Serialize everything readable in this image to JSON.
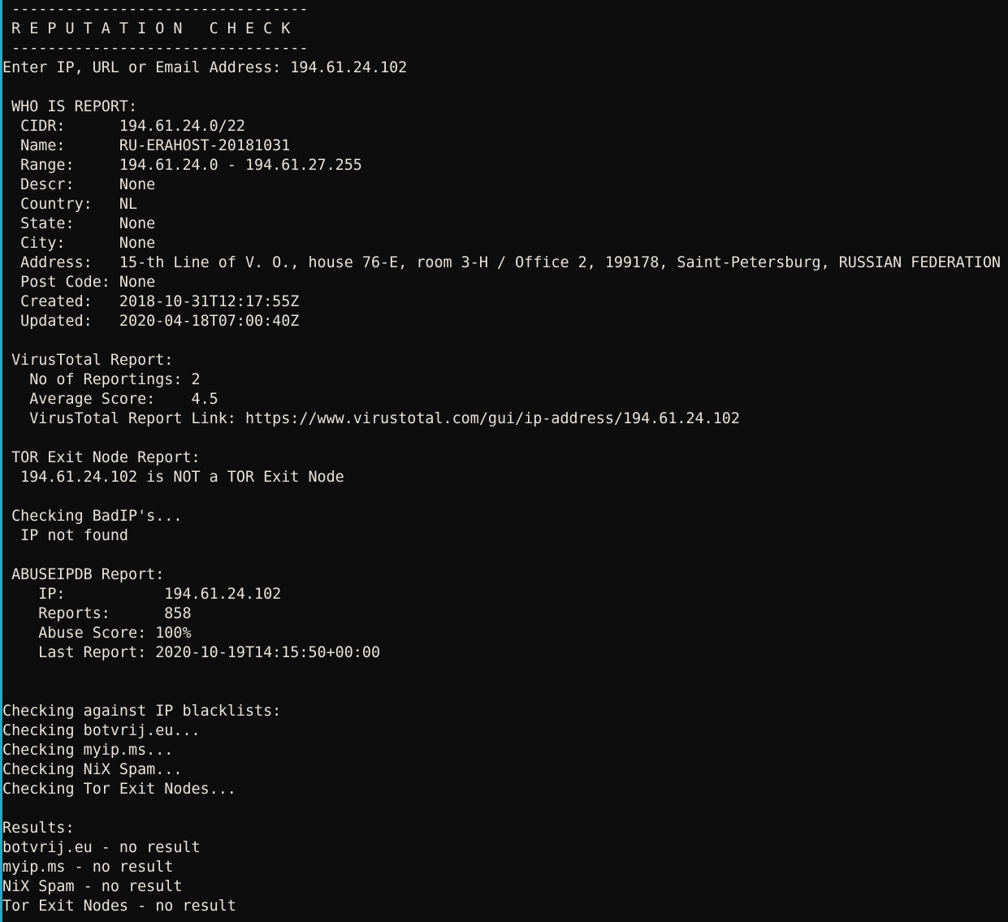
{
  "terminal": {
    "app_title": "Reputation Check",
    "background_color": "#0d0d0d",
    "text_color": "#e9e2da",
    "edge_accent_color": "#2aa8c4",
    "font_size_px": 18,
    "line_height_px": 24,
    "columns": 113,
    "rows": 47
  },
  "banner": {
    "rule_top": "---------------------------------",
    "title": "R E P U T A T I O N   C H E C K",
    "rule_bottom": "---------------------------------"
  },
  "prompt": {
    "label": "Enter IP, URL or Email Address:",
    "value": "194.61.24.102",
    "full_line": "Enter IP, URL or Email Address: 194.61.24.102"
  },
  "whois": {
    "heading": "WHO IS REPORT:",
    "fields": [
      {
        "label": "CIDR:",
        "value": "194.61.24.0/22"
      },
      {
        "label": "Name:",
        "value": "RU-ERAHOST-20181031"
      },
      {
        "label": "Range:",
        "value": "194.61.24.0 - 194.61.27.255"
      },
      {
        "label": "Descr:",
        "value": "None"
      },
      {
        "label": "Country:",
        "value": "NL"
      },
      {
        "label": "State:",
        "value": "None"
      },
      {
        "label": "City:",
        "value": "None"
      },
      {
        "label": "Address:",
        "value": "15-th Line of V. O., house 76-E, room 3-H / Office 2, 199178, Saint-Petersburg, RUSSIAN FEDERATION"
      },
      {
        "label": "Post Code:",
        "value": "None"
      },
      {
        "label": "Created:",
        "value": "2018-10-31T12:17:55Z"
      },
      {
        "label": "Updated:",
        "value": "2020-04-18T07:00:40Z"
      }
    ]
  },
  "virustotal": {
    "heading": "VirusTotal Report:",
    "no_of_reportings_label": "No of Reportings:",
    "no_of_reportings": "2",
    "average_score_label": "Average Score:",
    "average_score": "4.5",
    "report_link_label": "VirusTotal Report Link:",
    "report_link": "https://www.virustotal.com/gui/ip-address/194.61.24.102"
  },
  "tor": {
    "heading": "TOR Exit Node Report:",
    "result": "194.61.24.102 is NOT a TOR Exit Node"
  },
  "badip": {
    "heading": "Checking BadIP's...",
    "result": "IP not found"
  },
  "abuseipdb": {
    "heading": "ABUSEIPDB Report:",
    "fields": [
      {
        "label": "IP:",
        "value": "194.61.24.102"
      },
      {
        "label": "Reports:",
        "value": "858"
      },
      {
        "label": "Abuse Score:",
        "value": "100%"
      },
      {
        "label": "Last Report:",
        "value": "2020-10-19T14:15:50+00:00"
      }
    ]
  },
  "blacklists": {
    "heading": "Checking against IP blacklists:",
    "checking": [
      "Checking botvrij.eu...",
      "Checking myip.ms...",
      "Checking NiX Spam...",
      "Checking Tor Exit Nodes..."
    ],
    "results_heading": "Results:",
    "results": [
      {
        "source": "botvrij.eu",
        "outcome": "no result",
        "line": "botvrij.eu - no result"
      },
      {
        "source": "myip.ms",
        "outcome": "no result",
        "line": "myip.ms - no result"
      },
      {
        "source": "NiX Spam",
        "outcome": "no result",
        "line": "NiX Spam - no result"
      },
      {
        "source": "Tor Exit Nodes",
        "outcome": "no result",
        "line": "Tor Exit Nodes - no result"
      }
    ]
  },
  "console_lines": [
    " ---------------------------------",
    " R E P U T A T I O N   C H E C K",
    " ---------------------------------",
    "Enter IP, URL or Email Address: 194.61.24.102",
    "",
    " WHO IS REPORT:",
    "  CIDR:      194.61.24.0/22",
    "  Name:      RU-ERAHOST-20181031",
    "  Range:     194.61.24.0 - 194.61.27.255",
    "  Descr:     None",
    "  Country:   NL",
    "  State:     None",
    "  City:      None",
    "  Address:   15-th Line of V. O., house 76-E, room 3-H / Office 2, 199178, Saint-Petersburg, RUSSIAN FEDERATION",
    "  Post Code: None",
    "  Created:   2018-10-31T12:17:55Z",
    "  Updated:   2020-04-18T07:00:40Z",
    "",
    " VirusTotal Report:",
    "   No of Reportings: 2",
    "   Average Score:    4.5",
    "   VirusTotal Report Link: https://www.virustotal.com/gui/ip-address/194.61.24.102",
    "",
    " TOR Exit Node Report:",
    "  194.61.24.102 is NOT a TOR Exit Node",
    "",
    " Checking BadIP's...",
    "  IP not found",
    "",
    " ABUSEIPDB Report:",
    "    IP:           194.61.24.102",
    "    Reports:      858",
    "    Abuse Score: 100%",
    "    Last Report: 2020-10-19T14:15:50+00:00",
    "",
    "",
    "Checking against IP blacklists:",
    "Checking botvrij.eu...",
    "Checking myip.ms...",
    "Checking NiX Spam...",
    "Checking Tor Exit Nodes...",
    "",
    "Results:",
    "botvrij.eu - no result",
    "myip.ms - no result",
    "NiX Spam - no result",
    "Tor Exit Nodes - no result"
  ]
}
